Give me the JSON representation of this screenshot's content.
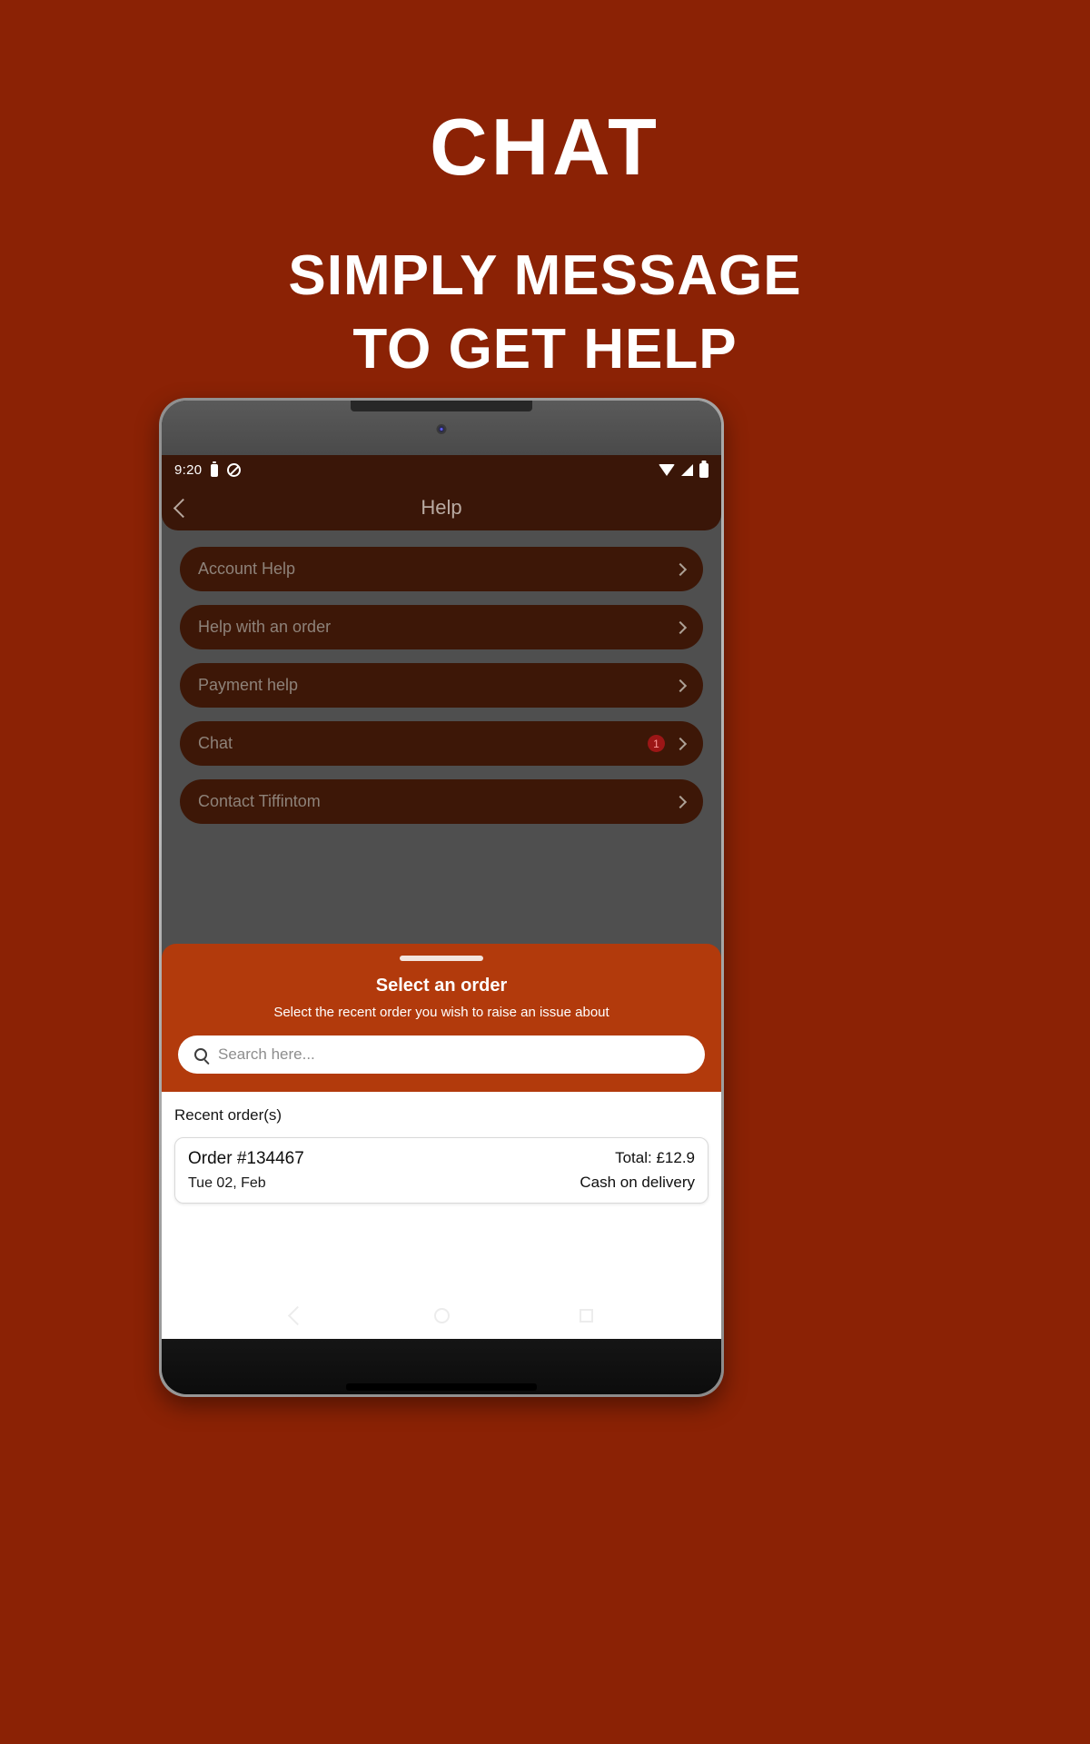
{
  "promo": {
    "title": "CHAT",
    "subtitle_lines": [
      "SIMPLY MESSAGE",
      "TO GET HELP"
    ],
    "background_color": "#8b2205",
    "text_color": "#ffffff"
  },
  "device": {
    "status_bar": {
      "time": "9:20",
      "left_icons": [
        "battery-icon",
        "do-not-disturb-icon"
      ],
      "right_icons": [
        "wifi-icon",
        "signal-icon",
        "battery-icon"
      ],
      "background_color": "#3a1608"
    },
    "app_bar": {
      "back_icon": "chevron-left-icon",
      "title": "Help",
      "background_color": "#3a1608",
      "title_color": "#b9aaa2"
    },
    "content_background_color": "#4f4f4f"
  },
  "menu": {
    "items": [
      {
        "label": "Account Help",
        "badge": null,
        "chevron": "chevron-right-icon"
      },
      {
        "label": "Help with an order",
        "badge": null,
        "chevron": "chevron-right-icon"
      },
      {
        "label": "Payment help",
        "badge": null,
        "chevron": "chevron-right-icon"
      },
      {
        "label": "Chat",
        "badge": "1",
        "chevron": "chevron-right-icon"
      },
      {
        "label": "Contact Tiffintom",
        "badge": null,
        "chevron": "chevron-right-icon"
      }
    ],
    "item_background_color": "#3d1707",
    "item_label_color": "#8e8279",
    "badge_background_color": "#9c1616"
  },
  "sheet": {
    "handle": "drag-handle",
    "title": "Select an order",
    "subtitle": "Select the recent order you wish to raise an issue about",
    "background_color": "#b23a0c",
    "search": {
      "icon": "search-icon",
      "value": "",
      "placeholder": "Search here..."
    }
  },
  "results": {
    "heading": "Recent order(s)",
    "orders": [
      {
        "order_id": "Order #134467",
        "date": "Tue 02, Feb",
        "total": "Total: £12.9",
        "payment": "Cash on delivery"
      }
    ]
  },
  "nav_bar": {
    "buttons": [
      "back-nav-icon",
      "home-nav-icon",
      "recents-nav-icon"
    ]
  }
}
